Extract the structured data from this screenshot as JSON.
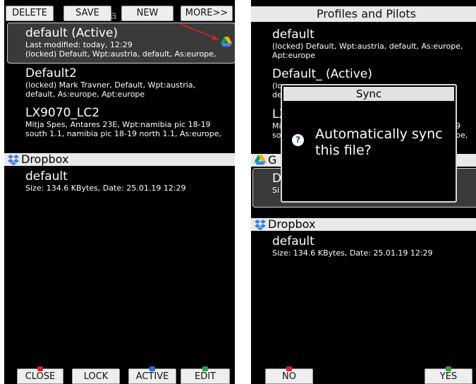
{
  "left": {
    "top_buttons": [
      "DELETE",
      "SAVE",
      "NEW",
      "MORE>>"
    ],
    "watermark": "a",
    "items": [
      {
        "title": "default (Active)",
        "lines": [
          "Last modified: today, 12:29",
          "(locked) Default, Wpt:austria, default, As:europe,"
        ]
      },
      {
        "title": "Default2",
        "lines": [
          "(locked) Mark Travner, Default, Wpt:austria,",
          "default, As:europe, Apt:europe"
        ]
      },
      {
        "title": "LX9070_LC2",
        "lines": [
          "Mitja Spes, Antares 23E, Wpt:namibia pic 18-19",
          "south 1.1, namibia pic 18-19 north 1.1, As:europe,"
        ]
      }
    ],
    "section": "Dropbox",
    "file": {
      "name": "default",
      "info": "Size: 134.6 KBytes, Date: 25.01.19 12:29"
    },
    "bottom_buttons": [
      "CLOSE",
      "LOCK",
      "ACTIVE",
      "EDIT"
    ]
  },
  "right": {
    "header": "Profiles and Pilots",
    "items": [
      {
        "title": "default",
        "lines": [
          "(locked) Default, Wpt:austria, default, As:europe,",
          "Apt:europe"
        ]
      },
      {
        "title": "Default_ (Active)",
        "lines": [
          "(lo",
          "de"
        ]
      },
      {
        "title": "LX",
        "lines": [
          "Mi",
          "so"
        ]
      }
    ],
    "right_fragments": [
      "9",
      "pe,"
    ],
    "gsection_letter": "G",
    "selected_fragments": [
      "D",
      "Si"
    ],
    "dialog": {
      "title": "Sync",
      "message": "Automatically sync this file?"
    },
    "section": "Dropbox",
    "file": {
      "name": "default",
      "info": "Size: 134.6 KBytes, Date: 25.01.19 12:29"
    },
    "bottom_buttons": [
      "NO",
      "YES"
    ]
  },
  "colors": {
    "annotation_arrow": "#e02020",
    "mark_red": "#d9232d",
    "mark_blue": "#2a6fd6",
    "mark_green": "#2ea043",
    "dropbox": "#3d7fe0"
  }
}
